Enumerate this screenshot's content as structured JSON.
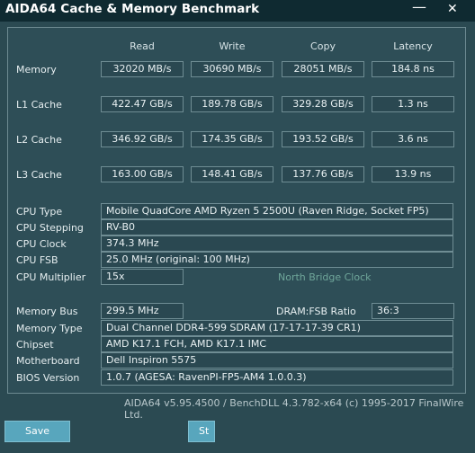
{
  "window": {
    "title": "AIDA64 Cache & Memory Benchmark",
    "minimize_glyph": "—",
    "close_glyph": "✕"
  },
  "columns": [
    "Read",
    "Write",
    "Copy",
    "Latency"
  ],
  "benchmarks": [
    {
      "label": "Memory",
      "read": "32020 MB/s",
      "write": "30690 MB/s",
      "copy": "28051 MB/s",
      "latency": "184.8 ns"
    },
    {
      "label": "L1 Cache",
      "read": "422.47 GB/s",
      "write": "189.78 GB/s",
      "copy": "329.28 GB/s",
      "latency": "1.3 ns"
    },
    {
      "label": "L2 Cache",
      "read": "346.92 GB/s",
      "write": "174.35 GB/s",
      "copy": "193.52 GB/s",
      "latency": "3.6 ns"
    },
    {
      "label": "L3 Cache",
      "read": "163.00 GB/s",
      "write": "148.41 GB/s",
      "copy": "137.76 GB/s",
      "latency": "13.9 ns"
    }
  ],
  "cpu": {
    "type_label": "CPU Type",
    "type": "Mobile QuadCore AMD Ryzen 5 2500U  (Raven Ridge, Socket FP5)",
    "stepping_label": "CPU Stepping",
    "stepping": "RV-B0",
    "clock_label": "CPU Clock",
    "clock": "374.3 MHz",
    "fsb_label": "CPU FSB",
    "fsb": "25.0 MHz  (original: 100 MHz)",
    "multiplier_label": "CPU Multiplier",
    "multiplier": "15x",
    "north_bridge_clock_label": "North Bridge Clock"
  },
  "memory": {
    "bus_label": "Memory Bus",
    "bus": "299.5 MHz",
    "dram_fsb_label": "DRAM:FSB Ratio",
    "dram_fsb": "36:3",
    "type_label": "Memory Type",
    "type": "Dual Channel DDR4-599 SDRAM  (17-17-17-39 CR1)",
    "chipset_label": "Chipset",
    "chipset": "AMD K17.1 FCH, AMD K17.1 IMC",
    "motherboard_label": "Motherboard",
    "motherboard": "Dell Inspiron 5575",
    "bios_label": "BIOS Version",
    "bios": "1.0.7  (AGESA: RavenPI-FP5-AM4 1.0.0.3)"
  },
  "footer": "AIDA64 v5.95.4500 / BenchDLL 4.3.782-x64  (c) 1995-2017 FinalWire Ltd.",
  "buttons": {
    "save": "Save",
    "start_partial": "St"
  }
}
